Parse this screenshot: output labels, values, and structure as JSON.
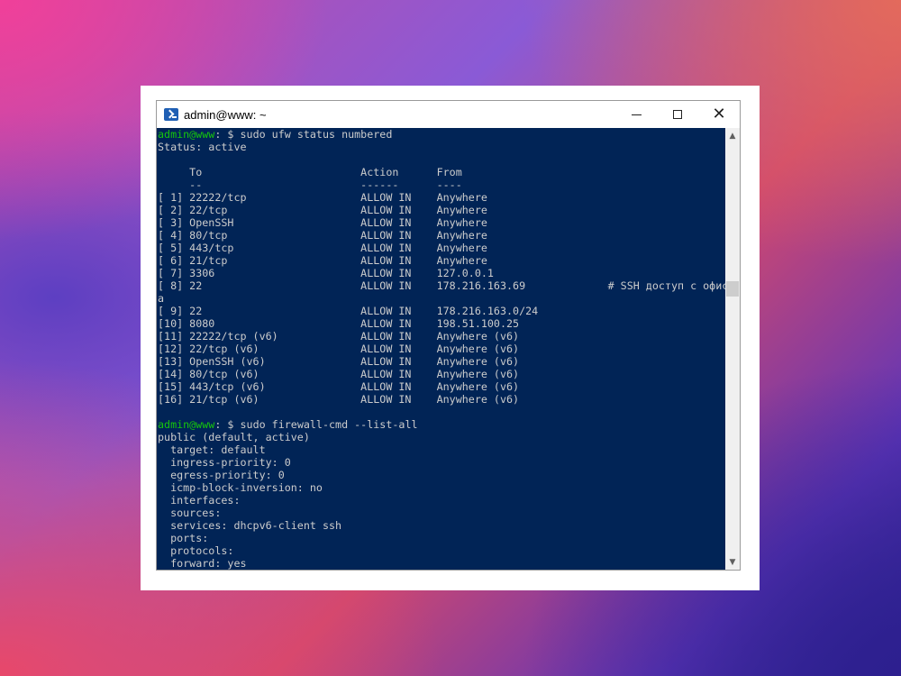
{
  "window": {
    "title": "admin@www: ~",
    "icon": "powershell-icon",
    "minimize_glyph": "minimize-icon",
    "maximize_glyph": "maximize-icon",
    "close_glyph": "✕"
  },
  "colors": {
    "console_bg": "#012456",
    "console_text": "#cccccc",
    "prompt_user": "#16c60c"
  },
  "scrollbar": {
    "up_arrow": "▲",
    "down_arrow": "▼"
  },
  "terminal": {
    "lines": [
      {
        "user": "admin@www",
        "rest": ": $ sudo ufw status numbered"
      },
      {
        "text": "Status: active"
      },
      {
        "text": ""
      },
      {
        "text": "     To                         Action      From"
      },
      {
        "text": "     --                         ------      ----"
      },
      {
        "text": "[ 1] 22222/tcp                  ALLOW IN    Anywhere"
      },
      {
        "text": "[ 2] 22/tcp                     ALLOW IN    Anywhere"
      },
      {
        "text": "[ 3] OpenSSH                    ALLOW IN    Anywhere"
      },
      {
        "text": "[ 4] 80/tcp                     ALLOW IN    Anywhere"
      },
      {
        "text": "[ 5] 443/tcp                    ALLOW IN    Anywhere"
      },
      {
        "text": "[ 6] 21/tcp                     ALLOW IN    Anywhere"
      },
      {
        "text": "[ 7] 3306                       ALLOW IN    127.0.0.1"
      },
      {
        "text": "[ 8] 22                         ALLOW IN    178.216.163.69             # SSH доступ с офис"
      },
      {
        "text": "а"
      },
      {
        "text": "[ 9] 22                         ALLOW IN    178.216.163.0/24"
      },
      {
        "text": "[10] 8080                       ALLOW IN    198.51.100.25"
      },
      {
        "text": "[11] 22222/tcp (v6)             ALLOW IN    Anywhere (v6)"
      },
      {
        "text": "[12] 22/tcp (v6)                ALLOW IN    Anywhere (v6)"
      },
      {
        "text": "[13] OpenSSH (v6)               ALLOW IN    Anywhere (v6)"
      },
      {
        "text": "[14] 80/tcp (v6)                ALLOW IN    Anywhere (v6)"
      },
      {
        "text": "[15] 443/tcp (v6)               ALLOW IN    Anywhere (v6)"
      },
      {
        "text": "[16] 21/tcp (v6)                ALLOW IN    Anywhere (v6)"
      },
      {
        "text": ""
      },
      {
        "user": "admin@www",
        "rest": ": $ sudo firewall-cmd --list-all"
      },
      {
        "text": "public (default, active)"
      },
      {
        "text": "  target: default"
      },
      {
        "text": "  ingress-priority: 0"
      },
      {
        "text": "  egress-priority: 0"
      },
      {
        "text": "  icmp-block-inversion: no"
      },
      {
        "text": "  interfaces:"
      },
      {
        "text": "  sources:"
      },
      {
        "text": "  services: dhcpv6-client ssh"
      },
      {
        "text": "  ports:"
      },
      {
        "text": "  protocols:"
      },
      {
        "text": "  forward: yes"
      }
    ]
  }
}
